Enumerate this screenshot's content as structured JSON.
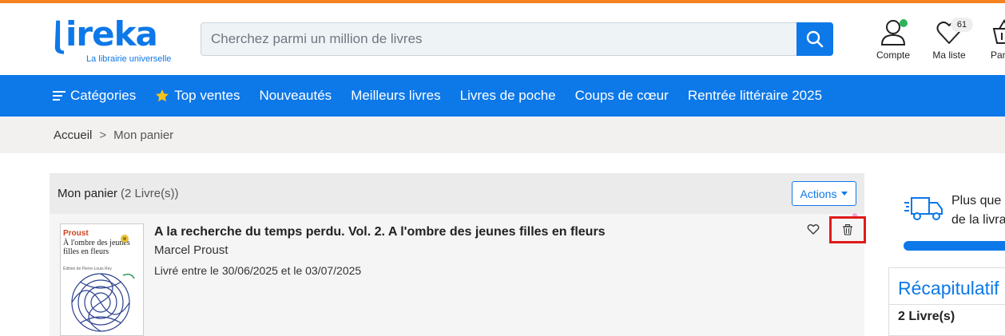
{
  "brand": {
    "name": "ireka",
    "tagline": "La librairie universelle",
    "color": "#0d78e8",
    "accent": "#f5821f"
  },
  "search": {
    "placeholder": "Cherchez parmi un million de livres"
  },
  "header_icons": {
    "account": {
      "label": "Compte",
      "icon": "user-icon"
    },
    "wishlist": {
      "label": "Ma liste",
      "icon": "heart-icon",
      "count": "61"
    },
    "basket": {
      "label": "Pan",
      "icon": "basket-icon"
    }
  },
  "nav": {
    "items": [
      {
        "label": "Catégories",
        "icon": "hamburger-icon"
      },
      {
        "label": "Top ventes",
        "icon": "star-icon"
      },
      {
        "label": "Nouveautés"
      },
      {
        "label": "Meilleurs livres"
      },
      {
        "label": "Livres de poche"
      },
      {
        "label": "Coups de cœur"
      },
      {
        "label": "Rentrée littéraire 2025"
      }
    ]
  },
  "breadcrumb": {
    "home": "Accueil",
    "separator": ">",
    "current": "Mon panier"
  },
  "cart": {
    "title": "Mon panier",
    "count_text": "(2 Livre(s))",
    "actions_label": "Actions",
    "items": [
      {
        "title": "A la recherche du temps perdu. Vol. 2. A l'ombre des jeunes filles en fleurs",
        "author": "Marcel Proust",
        "delivery": "Livré entre le 30/06/2025 et le 03/07/2025",
        "cover": {
          "author": "Proust",
          "title": "À l'ombre des jeunes filles en fleurs",
          "edition": "Édition de Pierre-Louis Rey"
        }
      }
    ]
  },
  "sidebar": {
    "shipping_text_1": "Plus que",
    "shipping_text_2": "de la livra",
    "recap_title": "Récapitulatif",
    "recap_count": "2 Livre(s)"
  }
}
